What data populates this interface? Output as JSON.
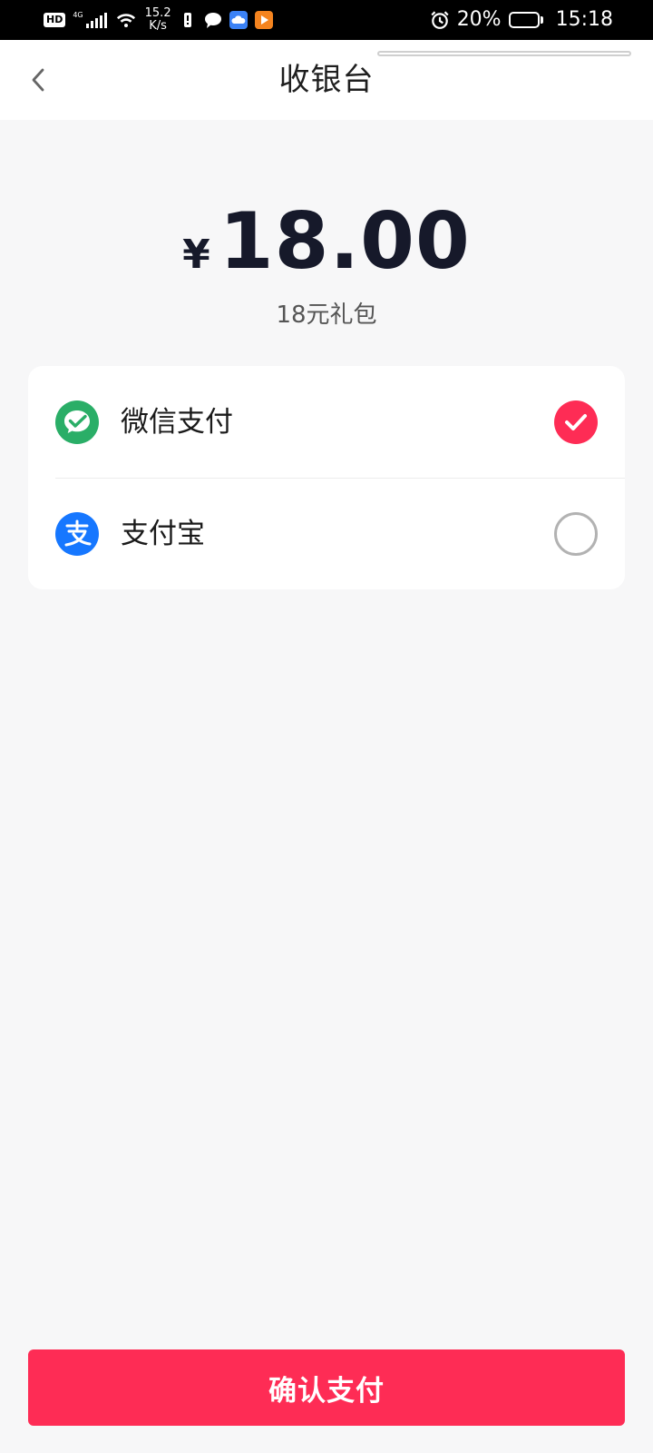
{
  "status_bar": {
    "hd": "HD",
    "network": "4G",
    "speed_value": "15.2",
    "speed_unit": "K/s",
    "battery_percent_label": "20%",
    "battery_level": 0.2,
    "time": "15:18"
  },
  "header": {
    "title": "收银台"
  },
  "order": {
    "currency_symbol": "¥",
    "amount": "18.00",
    "product_name": "18元礼包"
  },
  "payment_methods": [
    {
      "label": "微信支付",
      "icon": "wechat-pay-icon",
      "selected": true,
      "color": "#2aae67"
    },
    {
      "label": "支付宝",
      "icon": "alipay-icon",
      "selected": false,
      "color": "#1677ff"
    }
  ],
  "actions": {
    "confirm_label": "确认支付"
  },
  "colors": {
    "accent": "#fe2c55",
    "background": "#f7f7f8"
  }
}
